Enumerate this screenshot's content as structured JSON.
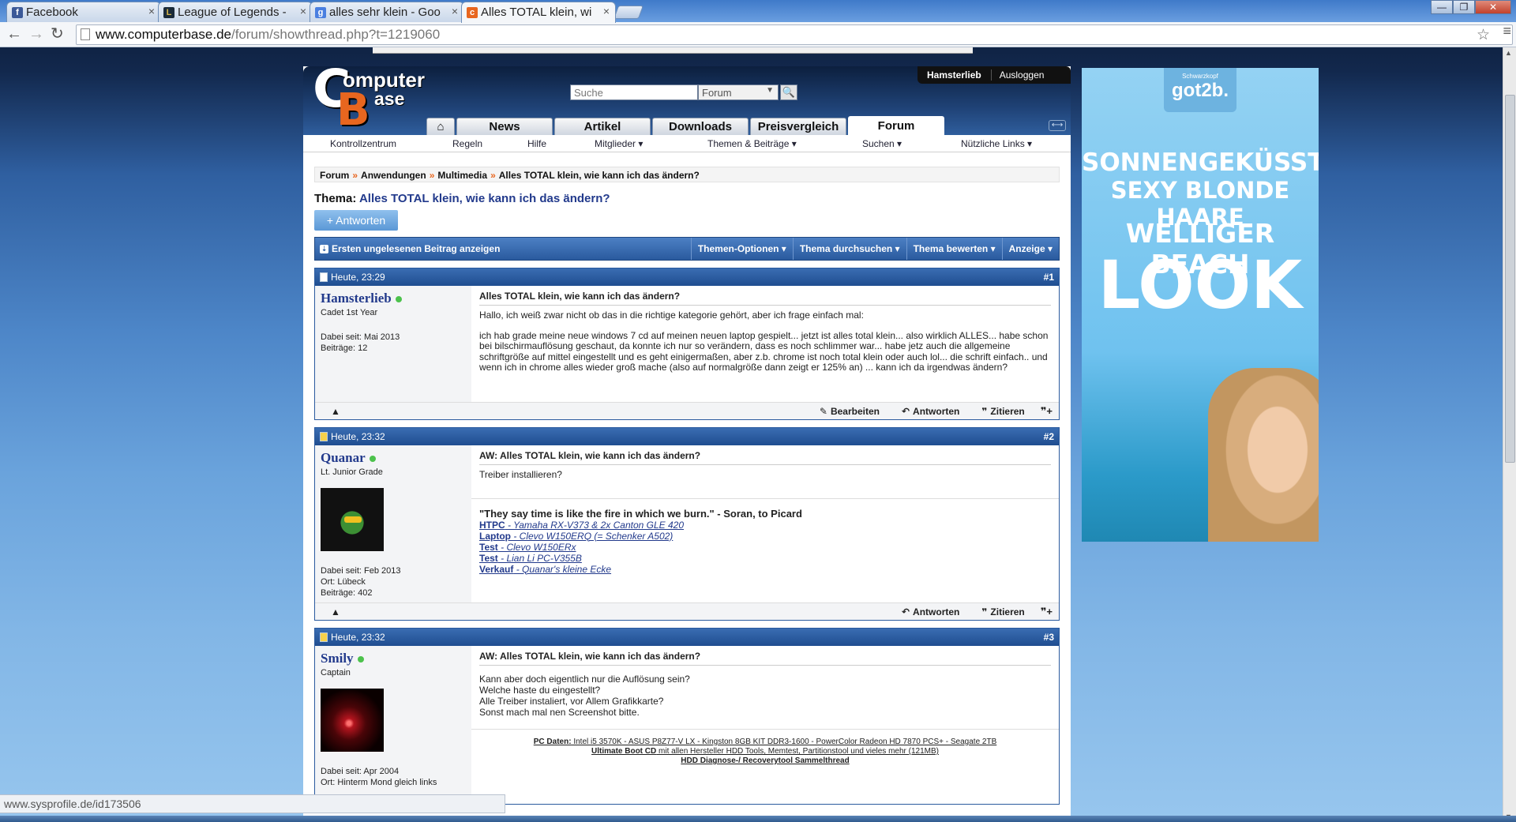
{
  "browser": {
    "tabs": [
      {
        "title": "Facebook",
        "favicon": "facebook-icon"
      },
      {
        "title": "League of Legends - ",
        "favicon": "lol-icon"
      },
      {
        "title": "alles sehr klein - Goo",
        "favicon": "google-icon"
      },
      {
        "title": "Alles TOTAL klein, wi",
        "favicon": "computerbase-icon"
      }
    ],
    "url_host": "www.computerbase.de",
    "url_path": "/forum/showthread.php?t=1219060",
    "status_text": "www.sysprofile.de/id173506"
  },
  "site": {
    "logo_line1": "omputer",
    "logo_line2": "ase",
    "logo_c": "C",
    "logo_b": "B",
    "user": "Hamsterlieb",
    "logout": "Ausloggen",
    "search_placeholder": "Suche",
    "search_scope": "Forum",
    "main_tabs": [
      "News",
      "Artikel",
      "Downloads",
      "Preisvergleich",
      "Forum"
    ],
    "sub_nav": [
      "Kontrollzentrum",
      "Regeln",
      "Hilfe",
      "Mitglieder ▾",
      "Themen & Beiträge ▾",
      "Suchen ▾",
      "Nützliche Links ▾"
    ]
  },
  "breadcrumb": [
    "Forum",
    "Anwendungen",
    "Multimedia",
    "Alles TOTAL klein, wie kann ich das ändern?"
  ],
  "thread": {
    "label": "Thema:",
    "title": "Alles TOTAL klein, wie kann ich das ändern?",
    "reply_button": "+ Antworten",
    "first_unread": "Ersten ungelesenen Beitrag anzeigen",
    "options": [
      "Themen-Optionen ▾",
      "Thema durchsuchen ▾",
      "Thema bewerten ▾",
      "Anzeige ▾"
    ]
  },
  "post_actions": {
    "edit": "Bearbeiten",
    "reply": "Antworten",
    "quote": "Zitieren"
  },
  "posts": [
    {
      "time": "Heute, 23:29",
      "num": "#1",
      "user": "Hamsterlieb",
      "rank": "Cadet 1st Year",
      "since": "Dabei seit: Mai 2013",
      "location": "",
      "count": "Beiträge: 12",
      "title": "Alles TOTAL klein, wie kann ich das ändern?",
      "p1": "Hallo, ich weiß zwar nicht ob das in die richtige kategorie gehört, aber ich frage einfach mal:",
      "p2": "ich hab grade meine neue windows 7 cd auf meinen neuen laptop gespielt... jetzt ist alles total klein... also wirklich ALLES... habe schon bei bilschirmauflösung geschaut, da konnte ich nur so verändern, dass es noch schlimmer war... habe jetz auch die allgemeine schriftgröße auf mittel eingestellt und es geht einigermaßen, aber z.b. chrome ist noch total klein oder auch lol... die schrift einfach.. und wenn ich in chrome alles wieder groß mache (also auf normalgröße dann zeigt er 125% an) ... kann ich da irgendwas ändern?"
    },
    {
      "time": "Heute, 23:32",
      "num": "#2",
      "user": "Quanar",
      "rank": "Lt. Junior Grade",
      "since": "Dabei seit: Feb 2013",
      "location": "Ort: Lübeck",
      "count": "Beiträge: 402",
      "title": "AW: Alles TOTAL klein, wie kann ich das ändern?",
      "p1": "Treiber installieren?",
      "sig_quote": "\"They say time is like the fire in which we burn.\" - Soran, to Picard",
      "sig_links": [
        {
          "label": "HTPC",
          "text": " - Yamaha RX-V373 & 2x Canton GLE 420"
        },
        {
          "label": "Laptop",
          "text": " - Clevo W150ERQ (= Schenker A502)"
        },
        {
          "label": "Test",
          "text": " - Clevo W150ERx"
        },
        {
          "label": "Test",
          "text": " - Lian Li PC-V355B"
        },
        {
          "label": "Verkauf",
          "text": " - Quanar's kleine Ecke"
        }
      ]
    },
    {
      "time": "Heute, 23:32",
      "num": "#3",
      "user": "Smily",
      "rank": "Captain",
      "since": "Dabei seit: Apr 2004",
      "location": "Ort: Hinterm Mond gleich links",
      "count": "",
      "title": "AW: Alles TOTAL klein, wie kann ich das ändern?",
      "lines": [
        "Kann aber doch eigentlich nur die Auflösung sein?",
        "Welche haste du eingestellt?",
        "Alle Treiber instaliert, vor Allem Grafikkarte?",
        "Sonst mach mal nen Screenshot bitte."
      ],
      "sig_lines": [
        {
          "label": "PC Daten:",
          "text": " Intel i5 3570K - ASUS P8Z77-V LX - Kingston 8GB KIT DDR3-1600 - PowerColor Radeon HD 7870 PCS+ - Seagate 2TB"
        },
        {
          "label": "Ultimate Boot CD",
          "text": " mit allen Hersteller HDD Tools, Memtest, Partitionstool und vieles mehr (121MB)"
        },
        {
          "label": "HDD Diagnose-/ Recoverytool Sammelthread",
          "text": ""
        }
      ]
    }
  ],
  "ad": {
    "brand": "Schwarzkopf",
    "name": "got2b.",
    "line1": "SONNENGEKÜSSTE",
    "line2": "SEXY BLONDE HAARE",
    "line3": "WELLIGER BEACH",
    "line4": "LOOK"
  },
  "colors": {
    "accent": "#2a5a9e",
    "link": "#223a8c",
    "orange": "#e8661f",
    "online": "#4cc24c"
  }
}
